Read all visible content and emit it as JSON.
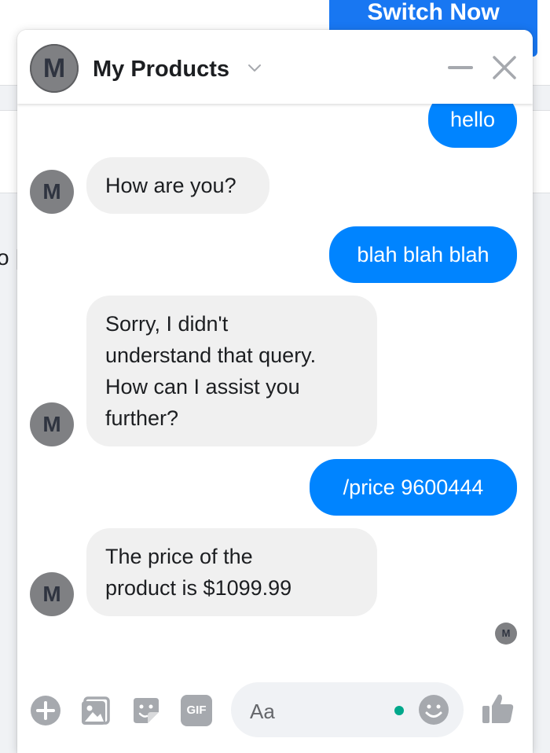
{
  "background": {
    "switch_button_label": "Switch Now",
    "fragment_text": "o |"
  },
  "chat": {
    "avatar_initial": "M",
    "title": "My Products"
  },
  "messages": [
    {
      "from": "user",
      "text": "hello"
    },
    {
      "from": "bot",
      "text": "How are you?"
    },
    {
      "from": "user",
      "text": "blah blah blah"
    },
    {
      "from": "bot",
      "text": "Sorry, I didn't\nunderstand that query.\nHow can I assist you\nfurther?"
    },
    {
      "from": "user",
      "text": "/price 9600444"
    },
    {
      "from": "bot",
      "text": "The price of the\nproduct is $1099.99"
    }
  ],
  "composer": {
    "placeholder": "Aa",
    "gif_label": "GIF"
  },
  "colors": {
    "outgoing": "#0084ff",
    "incoming": "#f0f0f0",
    "brand": "#1877f2",
    "active_dot": "#00a88b",
    "icon_gray": "#a6a9ae"
  },
  "icons": [
    "chevron-down-icon",
    "minimize-icon",
    "close-icon",
    "plus-icon",
    "photo-icon",
    "sticker-icon",
    "gif-icon",
    "emoji-icon",
    "like-icon"
  ]
}
